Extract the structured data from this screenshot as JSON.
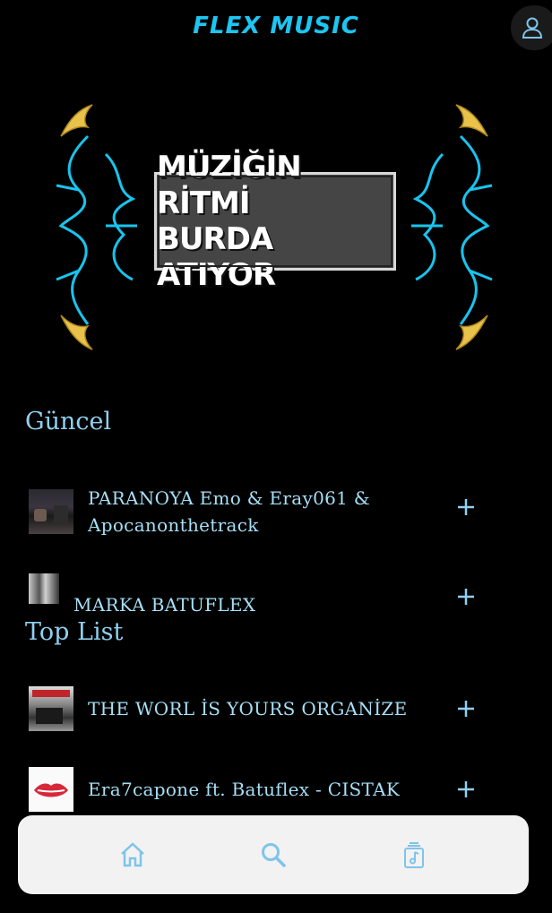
{
  "header": {
    "logo": "FLEX MUSIC"
  },
  "banner": {
    "line1": "MÜZİĞİN RİTMİ",
    "line2": "BURDA ATIYOR"
  },
  "sections": {
    "recent": {
      "title": "Güncel",
      "tracks": [
        {
          "title": "PARANOYA Emo & Eray061 & Apocanonthetrack"
        },
        {
          "title": "MARKA BATUFLEX"
        }
      ]
    },
    "top": {
      "title": "Top List",
      "tracks": [
        {
          "title": "THE WORL İS YOURS  ORGANİZE"
        },
        {
          "title": "Era7capone ft. Batuflex - CISTAK"
        }
      ]
    }
  },
  "colors": {
    "accent": "#1cc6f2",
    "text": "#8fd0f0",
    "nav_bg": "#f2f2f2",
    "nav_icon": "#7fc4ea"
  }
}
